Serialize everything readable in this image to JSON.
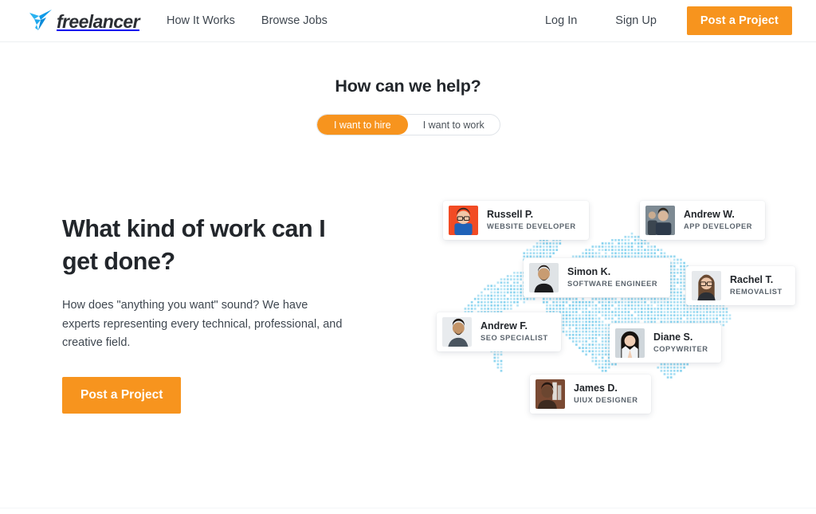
{
  "header": {
    "logo_text": "freelancer",
    "logo_icon": "hummingbird-logo-icon",
    "nav": [
      {
        "label": "How It Works"
      },
      {
        "label": "Browse Jobs"
      }
    ],
    "auth": {
      "login_label": "Log In",
      "signup_label": "Sign Up",
      "cta_label": "Post a Project"
    }
  },
  "help": {
    "title": "How can we help?",
    "toggle": {
      "options": [
        {
          "label": "I want to hire",
          "active": true
        },
        {
          "label": "I want to work",
          "active": false
        }
      ]
    }
  },
  "main": {
    "headline": "What kind of work can I get done?",
    "subcopy": "How does \"anything you want\" sound? We have experts representing every technical, professional, and creative field.",
    "cta_label": "Post a Project"
  },
  "map": {
    "icon": "dotted-world-map-icon",
    "dot_color": "#63c5ea"
  },
  "profiles": [
    {
      "name": "Russell P.",
      "role": "WEBSITE DEVELOPER",
      "avatar": "avatar-russell",
      "bg": "#f24b24",
      "skin": "#f0c7a8",
      "hair": "#2e2622",
      "shirt": "#1f62b8"
    },
    {
      "name": "Andrew W.",
      "role": "APP DEVELOPER",
      "avatar": "avatar-andrew-w",
      "bg": "#7d8a93",
      "skin": "#d8b79b",
      "hair": "#30281f",
      "shirt": "#2d3a4a"
    },
    {
      "name": "Simon K.",
      "role": "SOFTWARE ENGINEER",
      "avatar": "avatar-simon",
      "bg": "#dfe3e6",
      "skin": "#c89c72",
      "hair": "#241b16",
      "shirt": "#1c1c1e"
    },
    {
      "name": "Rachel T.",
      "role": "REMOVALIST",
      "avatar": "avatar-rachel",
      "bg": "#e6e9ec",
      "skin": "#ecc5a8",
      "hair": "#6a4a32",
      "shirt": "#2b2f35"
    },
    {
      "name": "Andrew F.",
      "role": "SEO SPECIALIST",
      "avatar": "avatar-andrew-f",
      "bg": "#e8ebee",
      "skin": "#c39468",
      "hair": "#1e1814",
      "shirt": "#4a5560"
    },
    {
      "name": "Diane S.",
      "role": "COPYWRITER",
      "avatar": "avatar-diane",
      "bg": "#cfd6db",
      "skin": "#efcdb4",
      "hair": "#16120f",
      "shirt": "#f2f4f6"
    },
    {
      "name": "James D.",
      "role": "UIUX DESIGNER",
      "avatar": "avatar-james",
      "bg": "#7a4a33",
      "skin": "#6b4630",
      "hair": "#241711",
      "shirt": "#3d2a1f"
    }
  ],
  "colors": {
    "accent_orange": "#f7941e",
    "text_dark": "#22262b",
    "text_body": "#3f4750",
    "map_dot": "#63c5ea"
  }
}
